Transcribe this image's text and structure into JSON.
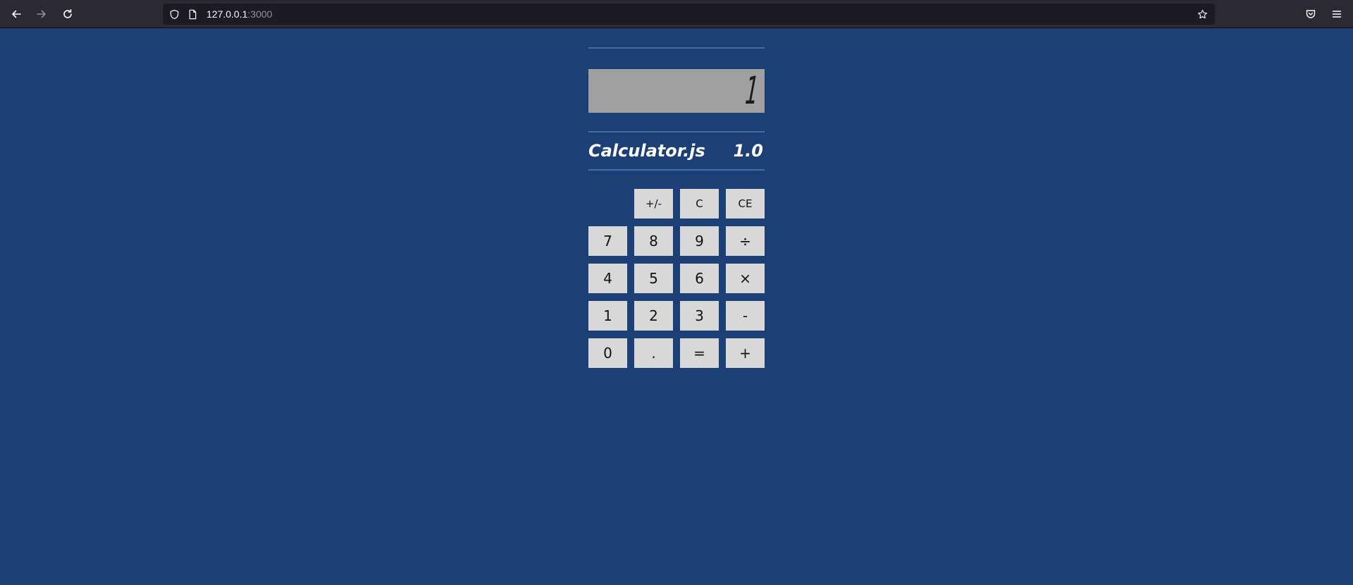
{
  "browser": {
    "url_host": "127.0.0.1",
    "url_port": ":3000",
    "icons": [
      "back-arrow-icon",
      "forward-arrow-icon",
      "reload-icon",
      "shield-icon",
      "page-icon",
      "star-icon",
      "pocket-icon",
      "menu-icon"
    ]
  },
  "calculator": {
    "display_value": "1",
    "brand_name": "Calculator.js",
    "version": "1.0",
    "colors": {
      "background": "#1c3f76",
      "display": "#a0a0a0",
      "key": "#d8d8d8",
      "rule": "#3f6fad"
    },
    "keys": {
      "sign": "+/-",
      "clear": "C",
      "clear_entry": "CE",
      "seven": "7",
      "eight": "8",
      "nine": "9",
      "divide": "÷",
      "four": "4",
      "five": "5",
      "six": "6",
      "multiply": "×",
      "one": "1",
      "two": "2",
      "three": "3",
      "minus": "-",
      "zero": "0",
      "decimal": ".",
      "equals": "=",
      "plus": "+"
    }
  }
}
